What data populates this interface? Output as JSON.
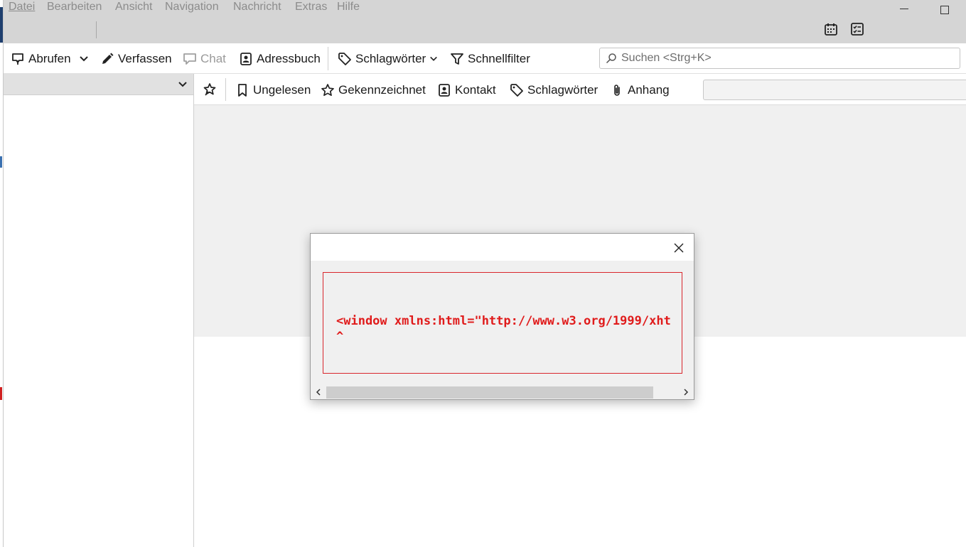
{
  "menu": {
    "items": [
      {
        "label": "Datei"
      },
      {
        "label": "Bearbeiten"
      },
      {
        "label": "Ansicht"
      },
      {
        "label": "Navigation"
      },
      {
        "label": "Nachricht"
      },
      {
        "label": "Extras"
      },
      {
        "label": "Hilfe"
      }
    ]
  },
  "tabbar": {
    "icons": [
      "calendar-icon",
      "tasks-icon"
    ]
  },
  "toolbar": {
    "get_messages": "Abrufen",
    "compose": "Verfassen",
    "chat": "Chat",
    "address_book": "Adressbuch",
    "tags": "Schlagwörter",
    "quick_filter": "Schnellfilter",
    "search_placeholder": "Suchen <Strg+K>"
  },
  "filterbar": {
    "unread": "Ungelesen",
    "starred": "Gekennzeichnet",
    "contact": "Kontakt",
    "tags": "Schlagwörter",
    "attachment": "Anhang"
  },
  "dialog": {
    "error_line_1": "<window xmlns:html=\"http://www.w3.org/1999/xht",
    "error_line_2": "^"
  },
  "colors": {
    "error": "#e01b1b",
    "chrome": "#d5d5d5",
    "pane": "#f0f0f0"
  }
}
